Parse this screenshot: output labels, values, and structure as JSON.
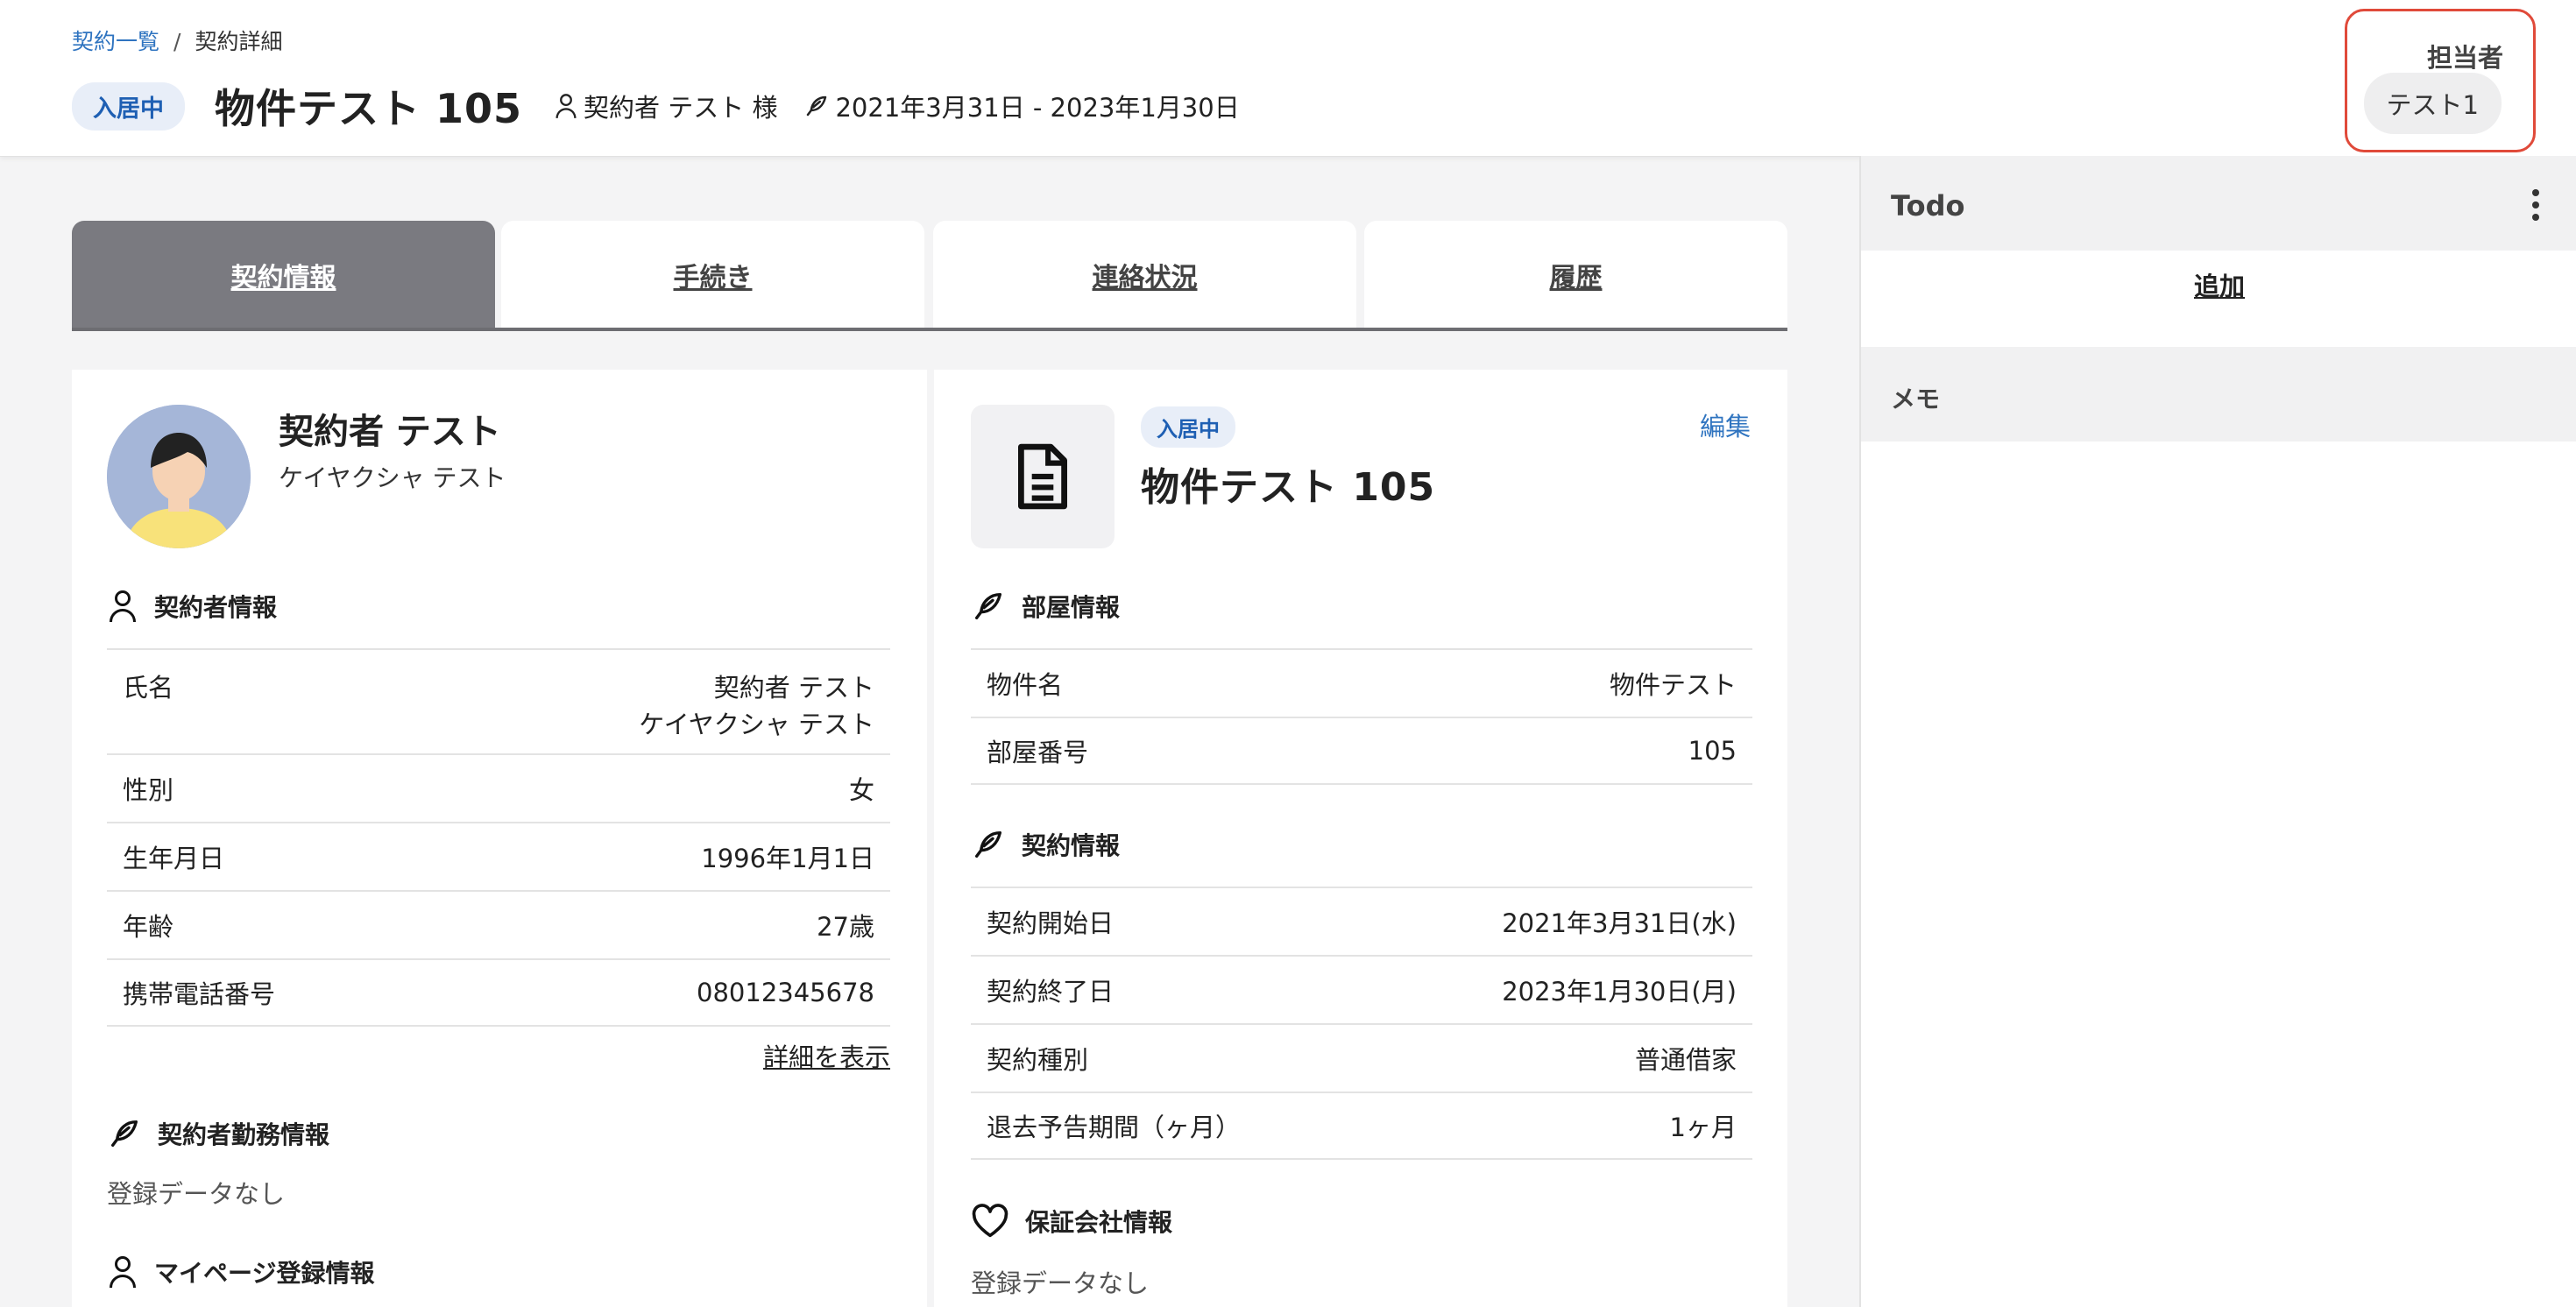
{
  "breadcrumb": {
    "parent": "契約一覧",
    "separator": "/",
    "current": "契約詳細"
  },
  "header": {
    "status": "入居中",
    "title": "物件テスト 105",
    "contractor": "契約者 テスト 様",
    "period": "2021年3月31日 - 2023年1月30日"
  },
  "assignee": {
    "label": "担当者",
    "name": "テスト1"
  },
  "tabs": [
    {
      "label": "契約情報",
      "active": true
    },
    {
      "label": "手続き",
      "active": false
    },
    {
      "label": "連絡状況",
      "active": false
    },
    {
      "label": "履歴",
      "active": false
    }
  ],
  "contractor_card": {
    "name": "契約者 テスト",
    "kana": "ケイヤクシャ テスト",
    "section_title": "契約者情報",
    "rows": [
      {
        "key": "氏名",
        "value": "契約者 テスト",
        "value2": "ケイヤクシャ テスト"
      },
      {
        "key": "性別",
        "value": "女"
      },
      {
        "key": "生年月日",
        "value": "1996年1月1日"
      },
      {
        "key": "年齢",
        "value": "27歳"
      },
      {
        "key": "携帯電話番号",
        "value": "08012345678"
      }
    ],
    "more_link": "詳細を表示",
    "work_title": "契約者勤務情報",
    "work_empty": "登録データなし",
    "mypage_title": "マイページ登録情報"
  },
  "property_card": {
    "status": "入居中",
    "edit": "編集",
    "title": "物件テスト 105",
    "room_section": "部屋情報",
    "room_rows": [
      {
        "key": "物件名",
        "value": "物件テスト"
      },
      {
        "key": "部屋番号",
        "value": "105"
      }
    ],
    "contract_section": "契約情報",
    "contract_rows": [
      {
        "key": "契約開始日",
        "value": "2021年3月31日(水)"
      },
      {
        "key": "契約終了日",
        "value": "2023年1月30日(月)"
      },
      {
        "key": "契約種別",
        "value": "普通借家"
      },
      {
        "key": "退去予告期間（ヶ月）",
        "value": "1ヶ月"
      }
    ],
    "guarantor_section": "保証会社情報",
    "guarantor_empty": "登録データなし"
  },
  "sidebar": {
    "todo_title": "Todo",
    "add_label": "追加",
    "memo_title": "メモ"
  },
  "colors": {
    "accent": "#2f74c0",
    "status_bg": "#e8eef8",
    "highlight": "#e04a3a",
    "tab_active": "#7a7a80"
  }
}
